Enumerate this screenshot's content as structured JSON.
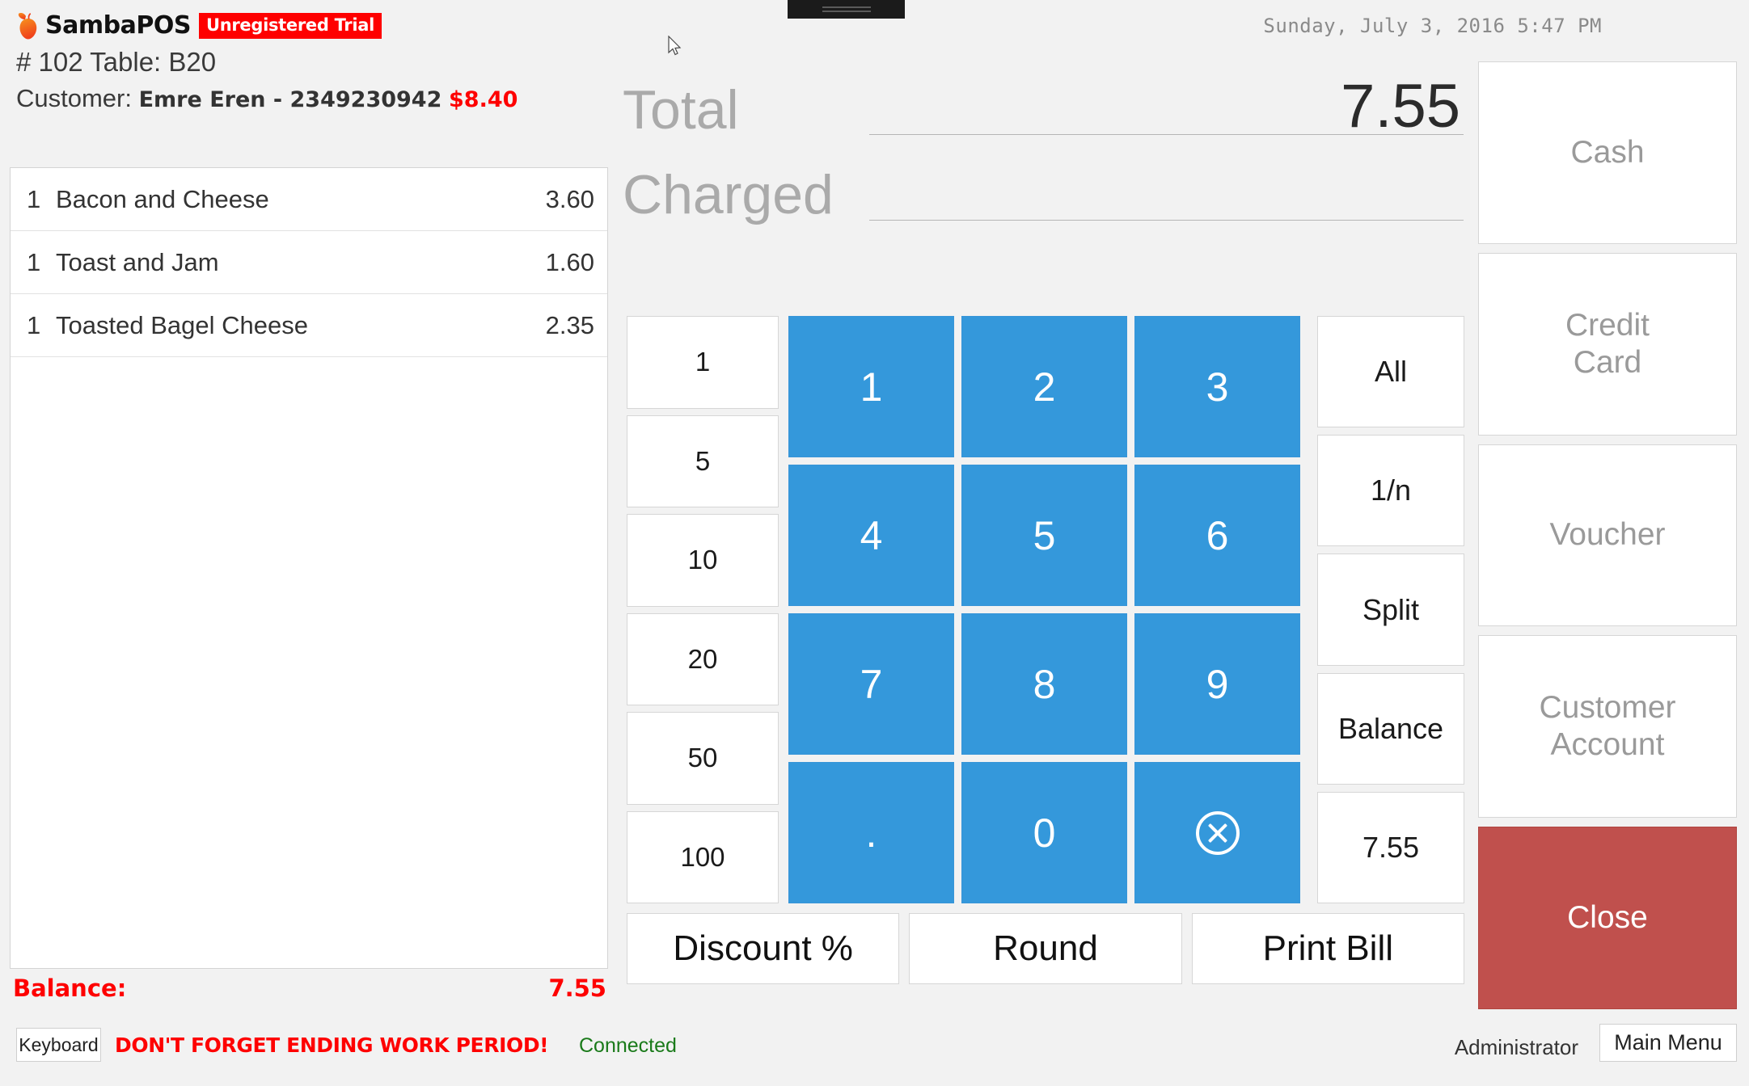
{
  "app": {
    "brand_name": "SambaPOS",
    "trial_badge": "Unregistered Trial",
    "logo_icon": "apple-logo-icon"
  },
  "header": {
    "ticket_line": "# 102 Table: B20",
    "customer_label": "Customer:",
    "customer_name": "Emre Eren - 2349230942",
    "customer_amount": "$8.40",
    "datetime": "Sunday, July 3, 2016 5:47 PM"
  },
  "order_list": {
    "columns": [
      "qty",
      "name",
      "price"
    ],
    "rows": [
      {
        "qty": "1",
        "name": "Bacon and Cheese",
        "price": "3.60"
      },
      {
        "qty": "1",
        "name": "Toast and Jam",
        "price": "1.60"
      },
      {
        "qty": "1",
        "name": "Toasted Bagel Cheese",
        "price": "2.35"
      }
    ],
    "balance_label": "Balance:",
    "balance_value": "7.55"
  },
  "totals": {
    "total_label": "Total",
    "total_value": "7.55",
    "charged_label": "Charged",
    "charged_value": ""
  },
  "quick_amounts": {
    "buttons": [
      "1",
      "5",
      "10",
      "20",
      "50",
      "100"
    ]
  },
  "numpad": {
    "keys": [
      "1",
      "2",
      "3",
      "4",
      "5",
      "6",
      "7",
      "8",
      "9",
      ".",
      "0",
      ""
    ],
    "clear_icon": "circled-x-clear-icon"
  },
  "functions": {
    "buttons": [
      "All",
      "1/n",
      "Split",
      "Balance",
      "7.55"
    ]
  },
  "actions": {
    "buttons": [
      "Discount %",
      "Round",
      "Print Bill"
    ]
  },
  "payment": {
    "buttons": [
      "Cash",
      "Credit\nCard",
      "Voucher",
      "Customer\nAccount"
    ],
    "close_label": "Close"
  },
  "status_bar": {
    "keyboard_label": "Keyboard",
    "warning": "DON'T FORGET ENDING WORK PERIOD!",
    "connection": "Connected",
    "user": "Administrator",
    "main_menu_label": "Main Menu"
  },
  "colors": {
    "accent_blue": "#3498db",
    "close_red": "#c0504d",
    "alert_red": "#fe0000",
    "connected_green": "#1a7a1a",
    "brand_orange": "#f15a24",
    "page_bg": "#f2f2f2"
  }
}
